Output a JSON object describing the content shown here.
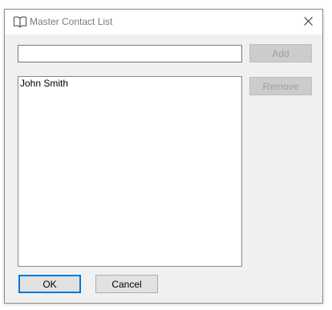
{
  "window": {
    "title": "Master Contact List",
    "title_icon": "open-book-icon",
    "close_icon": "close-icon"
  },
  "input": {
    "value": "",
    "placeholder": ""
  },
  "buttons": {
    "add_label": "Add",
    "remove_label": "Remove",
    "ok_label": "OK",
    "cancel_label": "Cancel"
  },
  "contacts": [
    {
      "name": "John Smith"
    }
  ],
  "colors": {
    "dialog_background": "#f0f0f0",
    "titlebar_background": "#ffffff",
    "title_text": "#7a7a7a",
    "default_button_border": "#0078d7",
    "disabled_button_background": "#cccccc",
    "disabled_button_text": "#a0a0a0"
  }
}
